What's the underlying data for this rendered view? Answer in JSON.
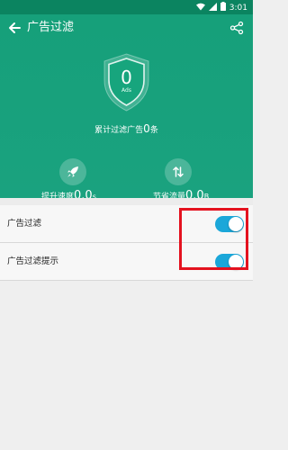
{
  "status_bar": {
    "time": "3:01"
  },
  "header": {
    "title": "广告过滤",
    "shield_count": "0",
    "shield_unit": "Ads",
    "total_prefix": "累计过滤广告",
    "total_value": "0",
    "total_suffix": "条",
    "speed": {
      "label": "提升速度",
      "value": "0.0",
      "unit": "s"
    },
    "traffic": {
      "label": "节省流量",
      "value": "0.0",
      "unit": "B"
    }
  },
  "settings": [
    {
      "label": "广告过滤",
      "enabled": true
    },
    {
      "label": "广告过滤提示",
      "enabled": true
    }
  ],
  "colors": {
    "header": "#1aa27f",
    "toggle": "#1ba7d9",
    "highlight": "#e4121f"
  }
}
